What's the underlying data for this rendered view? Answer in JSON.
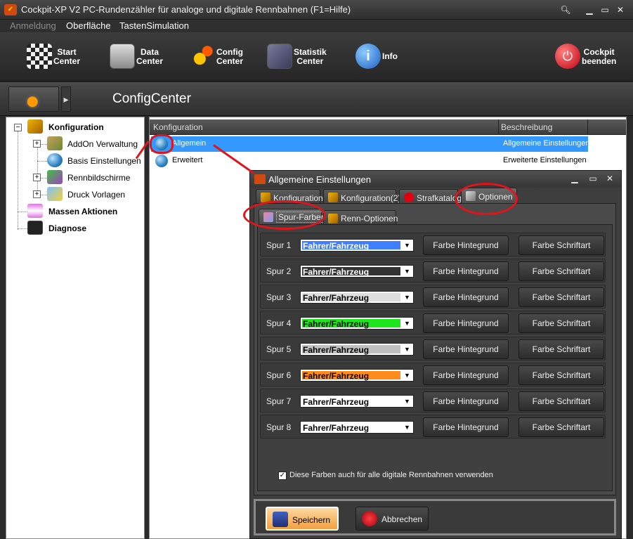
{
  "window": {
    "title": "Cockpit-XP V2 PC-Rundenzähler für analoge und digitale Rennbahnen (F1=Hilfe)",
    "app_icon": "cockpit-app-icon",
    "controls": [
      "search-icon",
      "minimize-icon",
      "restore-icon",
      "close-icon"
    ]
  },
  "menu": {
    "items": [
      {
        "label": "Anmeldung",
        "disabled": true
      },
      {
        "label": "Oberfläche",
        "disabled": false
      },
      {
        "label": "TastenSimulation",
        "disabled": false
      }
    ]
  },
  "toolbar": {
    "buttons": [
      {
        "line1": "Start",
        "line2": "Center",
        "icon": "checkered-flag-icon"
      },
      {
        "line1": "Data",
        "line2": "Center",
        "icon": "server-icon"
      },
      {
        "line1": "Config",
        "line2": "Center",
        "icon": "gears-icon"
      },
      {
        "line1": "Statistik",
        "line2": "Center",
        "icon": "chart-icon"
      },
      {
        "line1": "Info",
        "line2": "",
        "icon": "info-icon"
      },
      {
        "line1": "Cockpit",
        "line2": "beenden",
        "icon": "power-icon"
      }
    ]
  },
  "subheader": {
    "title": "ConfigCenter",
    "arrow": "▸"
  },
  "tree": {
    "root": "Konfiguration",
    "children": [
      "AddOn Verwaltung",
      "Basis Einstellungen",
      "Rennbildschirme",
      "Druck Vorlagen"
    ],
    "others": [
      "Massen Aktionen",
      "Diagnose"
    ]
  },
  "list": {
    "columns": [
      "Konfiguration",
      "Beschreibung"
    ],
    "rows": [
      {
        "name": "Allgemein",
        "desc": "Allgemeine Einstellungen",
        "selected": true
      },
      {
        "name": "Erweitert",
        "desc": "Erweiterte Einstellungen",
        "selected": false
      }
    ]
  },
  "dialog": {
    "title": "Allgemeine Einstellungen",
    "tabs": [
      "Konfiguration",
      "Konfiguration(2)",
      "Strafkatalog",
      "Optionen"
    ],
    "active_tab": "Optionen",
    "subtabs": [
      "Spur-Farben",
      "Renn-Optionen"
    ],
    "active_subtab": "Spur-Farben",
    "lanes": [
      {
        "label": "Spur 1",
        "value": "Fahrer/Fahrzeug",
        "color": "#3f7fff",
        "text_color": "#ffffff"
      },
      {
        "label": "Spur 2",
        "value": "Fahrer/Fahrzeug",
        "color": "#333333",
        "text_color": "#ffffff"
      },
      {
        "label": "Spur 3",
        "value": "Fahrer/Fahrzeug",
        "color": "#dddddd",
        "text_color": "#000000"
      },
      {
        "label": "Spur 4",
        "value": "Fahrer/Fahrzeug",
        "color": "#1ee61e",
        "text_color": "#000000"
      },
      {
        "label": "Spur 5",
        "value": "Fahrer/Fahrzeug",
        "color": "#c0c0c0",
        "text_color": "#000000"
      },
      {
        "label": "Spur 6",
        "value": "Fahrer/Fahrzeug",
        "color": "#ff8c1a",
        "text_color": "#000000"
      },
      {
        "label": "Spur 7",
        "value": "Fahrer/Fahrzeug",
        "color": "#ffffff",
        "text_color": "#000000"
      },
      {
        "label": "Spur 8",
        "value": "Fahrer/Fahrzeug",
        "color": "#ffffff",
        "text_color": "#000000"
      }
    ],
    "btn_bg": "Farbe Hintegrund",
    "btn_font": "Farbe Schriftart",
    "checkbox_label": "Diese Farben auch für alle digitale Rennbahnen verwenden",
    "checkbox_checked": true,
    "save": "Speichern",
    "cancel": "Abbrechen"
  }
}
